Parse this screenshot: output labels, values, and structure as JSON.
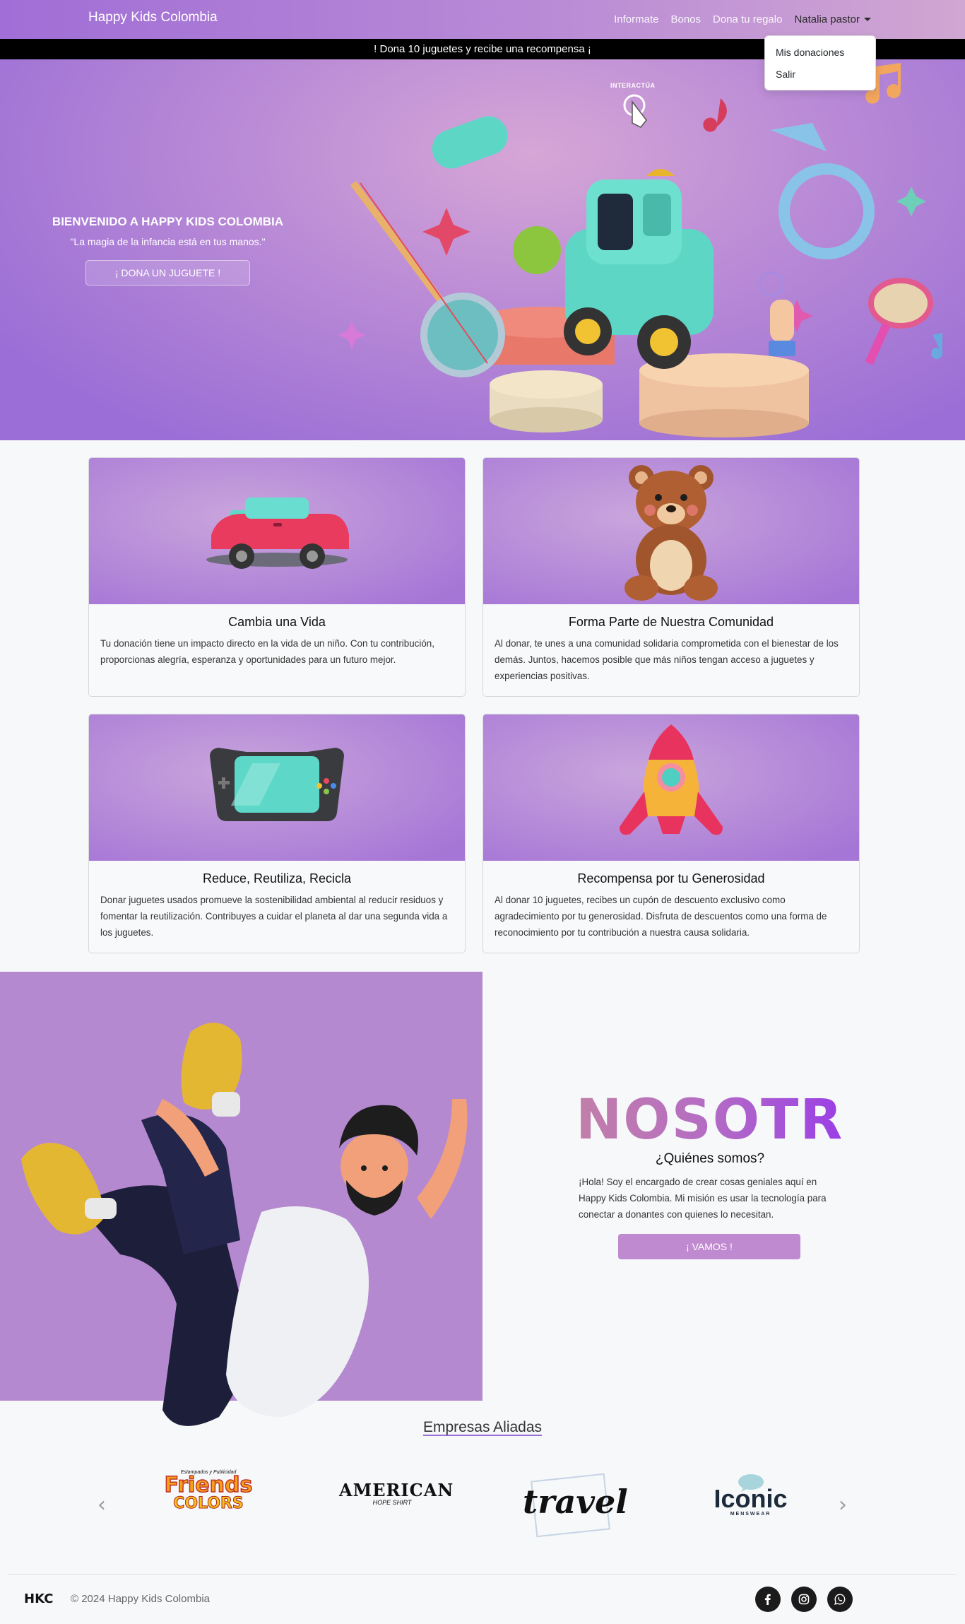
{
  "nav": {
    "brand": "Happy Kids Colombia",
    "links": [
      "Informate",
      "Bonos",
      "Dona tu regalo"
    ],
    "user": "Natalia pastor",
    "dropdown": [
      "Mis donaciones",
      "Salir"
    ]
  },
  "promo": "! Dona 10 juguetes y recibe una recompensa ¡",
  "hero": {
    "title": "BIENVENIDO A HAPPY KIDS COLOMBIA",
    "quote": "\"La magia de la infancia está en tus manos.\"",
    "button": "¡ DONA UN JUGUETE !",
    "interact": "INTERACTÚA"
  },
  "cards": [
    {
      "title": "Cambia una Vida",
      "text": "Tu donación tiene un impacto directo en la vida de un niño. Con tu contribución, proporcionas alegría, esperanza y oportunidades para un futuro mejor."
    },
    {
      "title": "Forma Parte de Nuestra Comunidad",
      "text": "Al donar, te unes a una comunidad solidaria comprometida con el bienestar de los demás. Juntos, hacemos posible que más niños tengan acceso a juguetes y experiencias positivas."
    },
    {
      "title": "Reduce, Reutiliza, Recicla",
      "text": "Donar juguetes usados promueve la sostenibilidad ambiental al reducir residuos y fomentar la reutilización. Contribuyes a cuidar el planeta al dar una segunda vida a los juguetes."
    },
    {
      "title": "Recompensa por tu Generosidad",
      "text": "Al donar 10 juguetes, recibes un cupón de descuento exclusivo como agradecimiento por tu generosidad. Disfruta de descuentos como una forma de reconocimiento por tu contribución a nuestra causa solidaria."
    }
  ],
  "about": {
    "big": "NOSOTROS",
    "subtitle": "¿Quiénes somos?",
    "text": "¡Hola! Soy el encargado de crear cosas geniales aquí en Happy Kids Colombia. Mi misión es usar la tecnología para conectar a donantes con quienes lo necesitan.",
    "button": "¡ VAMOS !"
  },
  "partners": {
    "title": "Empresas Aliadas",
    "logos": [
      {
        "top": "Estampados y Publicidad",
        "main": "Friends",
        "sub": "COLORS"
      },
      {
        "main": "AMERICAN",
        "sub": "HOPE SHIRT"
      },
      {
        "main": "travel"
      },
      {
        "main": "Iconic",
        "sub": "MENSWEAR"
      }
    ],
    "prev": "‹",
    "next": "›"
  },
  "footer": {
    "brand": "HKC",
    "copyright": "© 2024 Happy Kids Colombia",
    "social": [
      "facebook-icon",
      "instagram-icon",
      "whatsapp-icon"
    ]
  }
}
